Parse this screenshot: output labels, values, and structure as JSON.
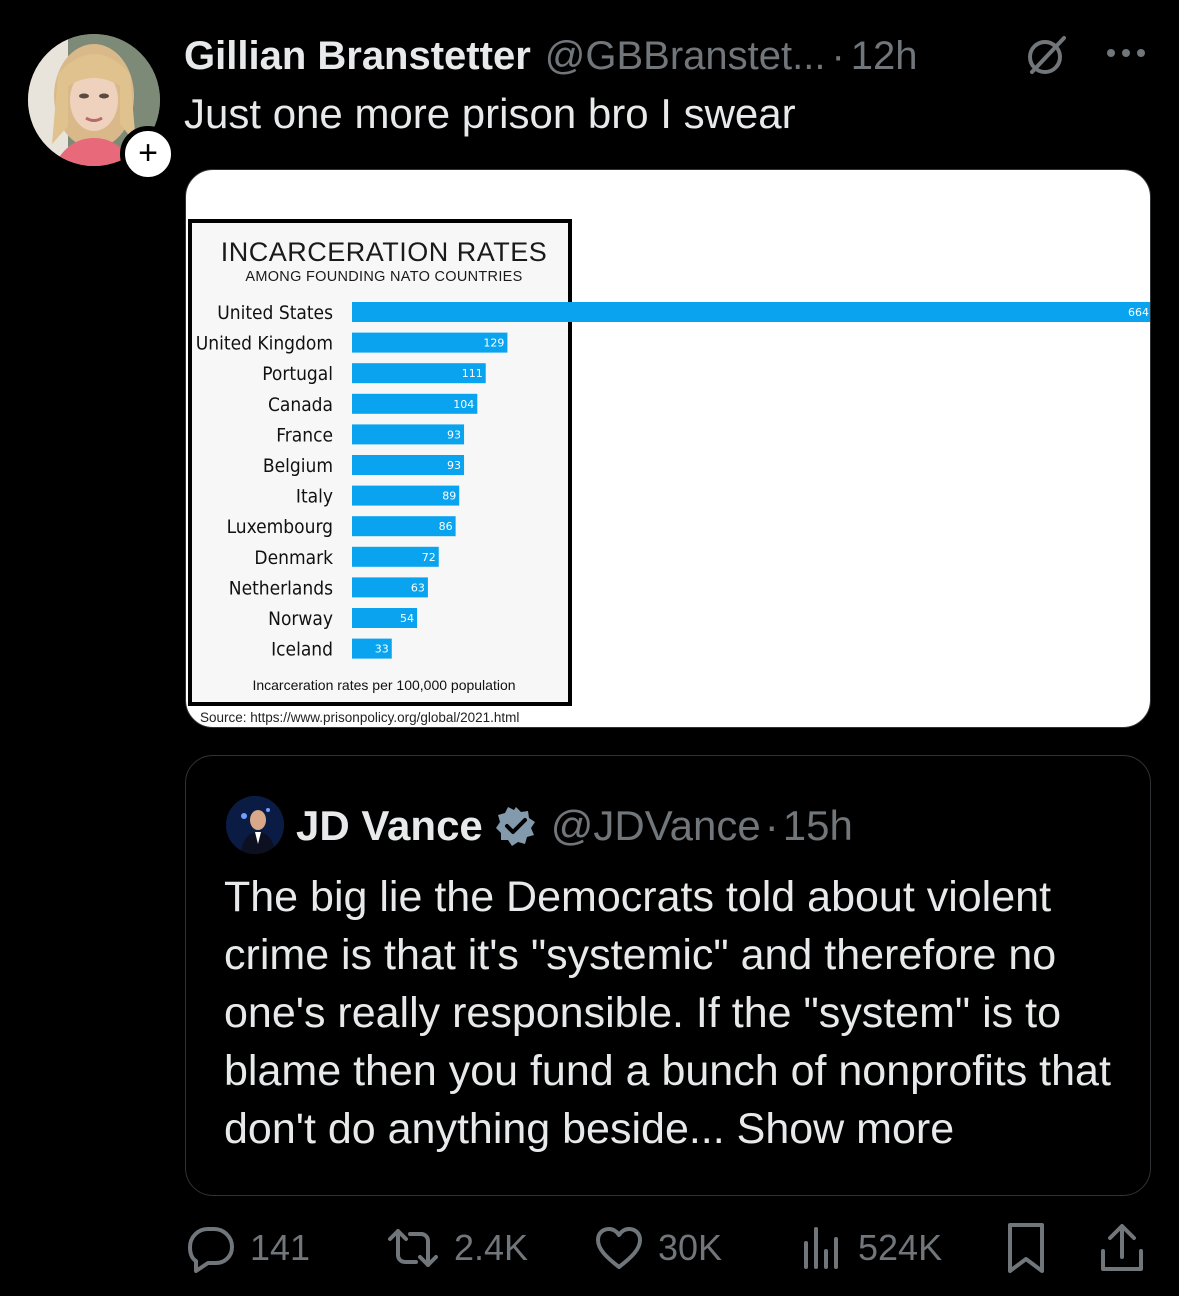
{
  "tweet": {
    "author_name": "Gillian Branstetter",
    "author_handle": "@GBBranstet...",
    "separator": "·",
    "time": "12h",
    "text": "Just one more prison bro I swear",
    "follow_symbol": "+",
    "icons": {
      "grok": "grok-icon",
      "more": "more-icon",
      "avatar": "profile-photo"
    }
  },
  "chart_data": {
    "type": "bar",
    "orientation": "horizontal",
    "title": "INCARCERATION RATES",
    "subtitle": "AMONG FOUNDING NATO COUNTRIES",
    "footer": "Incarceration rates per 100,000 population",
    "source": "Source: https://www.prisonpolicy.org/global/2021.html",
    "bar_color": "#09a3ef",
    "categories": [
      "United States",
      "United Kingdom",
      "Portugal",
      "Canada",
      "France",
      "Belgium",
      "Italy",
      "Luxembourg",
      "Denmark",
      "Netherlands",
      "Norway",
      "Iceland"
    ],
    "values": [
      664,
      129,
      111,
      104,
      93,
      93,
      89,
      86,
      72,
      63,
      54,
      33
    ],
    "value_labels": [
      "664",
      "129",
      "111",
      "104",
      "93",
      "93",
      "89",
      "86",
      "72",
      "63",
      "54",
      "33"
    ],
    "xlim": [
      0,
      664
    ]
  },
  "quote": {
    "author_name": "JD Vance",
    "author_handle": "@JDVance",
    "separator": "·",
    "time": "15h",
    "text": "The big lie the Democrats told about violent crime is that it's \"systemic\" and therefore no one's really responsible. If the \"system\" is to blame then you fund a bunch of nonprofits that don't do anything beside...",
    "show_more": "Show more",
    "verified_color": "#829aab",
    "icons": {
      "verified": "verified-badge-icon"
    }
  },
  "actions": {
    "replies": "141",
    "reposts": "2.4K",
    "likes": "30K",
    "views": "524K",
    "icons": [
      "reply-icon",
      "repost-icon",
      "like-icon",
      "views-icon",
      "bookmark-icon",
      "share-icon"
    ]
  },
  "colors": {
    "background": "#000000",
    "text": "#e7e9ea",
    "muted": "#71767b",
    "border": "#2f3336"
  }
}
